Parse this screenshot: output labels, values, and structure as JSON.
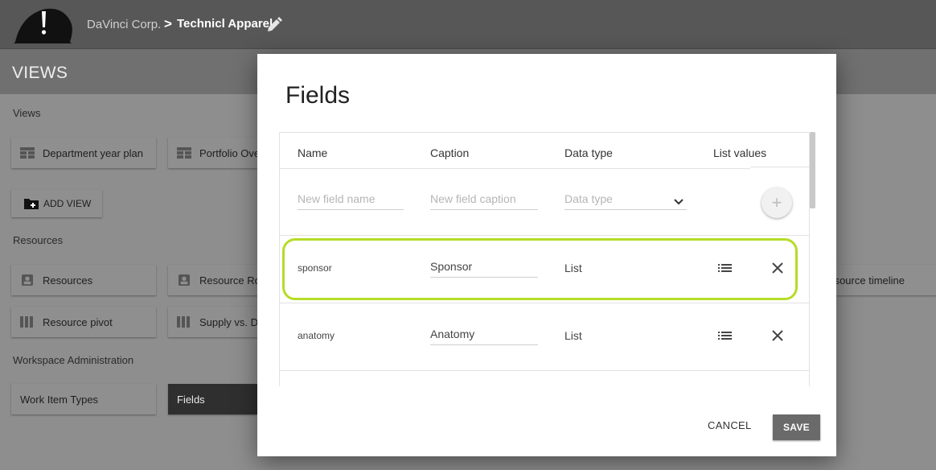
{
  "topbar": {
    "org": "DaVinci Corp.",
    "separator": ">",
    "project": "Technicl Apparel"
  },
  "views_header": {
    "title": "VIEWS"
  },
  "sections": {
    "views": "Views",
    "resources": "Resources",
    "admin": "Workspace Administration"
  },
  "views_cards": [
    {
      "label": "Department year plan",
      "icon": "table-icon"
    },
    {
      "label": "Portfolio Overview",
      "icon": "table-icon"
    }
  ],
  "add_view": {
    "label": "ADD VIEW",
    "icon": "folder-add-icon"
  },
  "resource_cards": [
    {
      "label": "Resources",
      "icon": "person-card-icon"
    },
    {
      "label": "Resource Roles",
      "icon": "person-card-icon"
    },
    {
      "label": "Resource timeline",
      "icon": "timeline-icon"
    },
    {
      "label": "Resource pivot",
      "icon": "columns-icon"
    },
    {
      "label": "Supply vs. Demand",
      "icon": "columns-icon"
    }
  ],
  "admin_cards": [
    {
      "label": "Work Item Types",
      "selected": false
    },
    {
      "label": "Fields",
      "selected": true
    }
  ],
  "dialog": {
    "title": "Fields",
    "columns": {
      "name": "Name",
      "caption": "Caption",
      "data_type": "Data type",
      "list_values": "List values"
    },
    "new_row": {
      "name_placeholder": "New field name",
      "caption_placeholder": "New field caption",
      "type_placeholder": "Data type",
      "add_icon": "plus-icon"
    },
    "rows": [
      {
        "name": "sponsor",
        "caption": "Sponsor",
        "type": "List",
        "highlighted": true
      },
      {
        "name": "anatomy",
        "caption": "Anatomy",
        "type": "List",
        "highlighted": false
      }
    ],
    "cancel_label": "CANCEL",
    "save_label": "SAVE"
  },
  "colors": {
    "highlight": "#b5dc28",
    "topbar": "#575757",
    "save_button": "#6a6a6a"
  }
}
